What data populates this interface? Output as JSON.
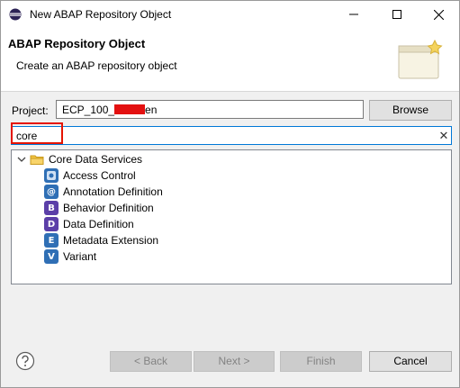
{
  "window": {
    "title": "New ABAP Repository Object"
  },
  "banner": {
    "title": "ABAP Repository Object",
    "description": "Create an ABAP repository object"
  },
  "project": {
    "label": "Project:",
    "value_prefix": "ECP_100_",
    "value_suffix": "en",
    "browse_label": "Browse"
  },
  "search": {
    "value": "core",
    "clear_glyph": "✕"
  },
  "tree": {
    "category": {
      "label": "Core Data Services",
      "icon": "folder-icon",
      "expanded": true
    },
    "items": [
      {
        "label": "Access Control",
        "icon": "access-control-icon",
        "color": "#2f6fb5"
      },
      {
        "label": "Annotation Definition",
        "icon": "annotation-definition-icon",
        "color": "#2f6fb5"
      },
      {
        "label": "Behavior Definition",
        "icon": "behavior-definition-icon",
        "color": "#5b3fa8"
      },
      {
        "label": "Data Definition",
        "icon": "data-definition-icon",
        "color": "#5b3fa8"
      },
      {
        "label": "Metadata Extension",
        "icon": "metadata-extension-icon",
        "color": "#2f6fb5"
      },
      {
        "label": "Variant",
        "icon": "variant-icon",
        "color": "#2f6fb5"
      }
    ]
  },
  "footer": {
    "back_label": "< Back",
    "next_label": "Next >",
    "finish_label": "Finish",
    "cancel_label": "Cancel"
  }
}
